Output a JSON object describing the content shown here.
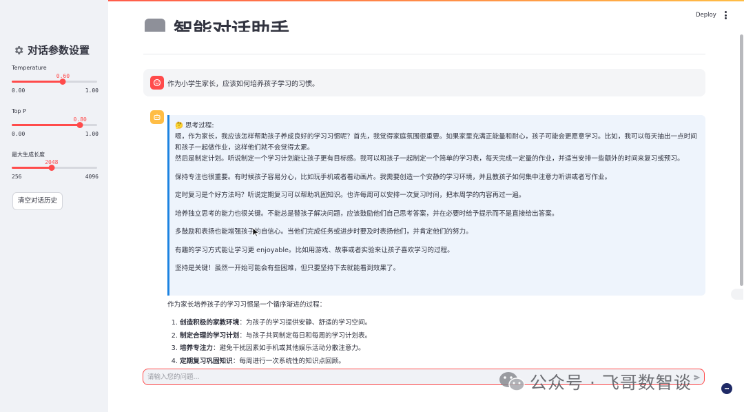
{
  "sidebar": {
    "title": "对话参数设置",
    "icon": "gear-icon",
    "sliders": [
      {
        "label": "Temperature",
        "value": "0.60",
        "min": "0.00",
        "max": "1.00",
        "fraction": 0.6
      },
      {
        "label": "Top P",
        "value": "0.80",
        "min": "0.00",
        "max": "1.00",
        "fraction": 0.8
      },
      {
        "label": "最大生成长度",
        "value": "2048",
        "min": "256",
        "max": "4096",
        "fraction": 0.4667
      }
    ],
    "clear_button": "清空对话历史"
  },
  "header": {
    "deploy": "Deploy",
    "title": "智能对话助手"
  },
  "messages": {
    "user": "作为小学生家长，应该如何培养孩子学习的习惯。",
    "thinking": {
      "emoji": "🤔",
      "heading": "思考过程:",
      "paragraphs": [
        "嗯，作为家长，我应该怎样帮助孩子养成良好的学习习惯呢？首先，我觉得家庭氛围很重要。如果家里充满正能量和耐心，孩子可能会更愿意学习。比如，我可以每天抽出一点时间和孩子一起做作业，这样他们就不会觉得太累。\n然后是制定计划。听说制定一个学习计划能让孩子更有目标感。我可以和孩子一起制定一个简单的学习表，每天完成一定量的作业，并适当安排一些额外的时间来复习或预习。",
        "保持专注也很重要。有时候孩子容易分心，比如玩手机或者看动画片。我需要创造一个安静的学习环境，并且教孩子如何集中注意力听讲或者写作业。",
        "定时复习是个好方法吗？听说定期复习可以帮助巩固知识。也许每周可以安排一次复习时间，把本周学的内容再过一遍。",
        "培养独立思考的能力也很关键。不能总是替孩子解决问题，应该鼓励他们自己思考答案，并在必要时给予提示而不是直接给出答案。",
        "多鼓励和表扬也能增强孩子的自信心。当他们完成任务或进步时要及时表扬他们，并肯定他们的努力。",
        "有趣的学习方式能让学习更 enjoyable。比如用游戏、故事或者实验来让孩子喜欢学习的过程。",
        "坚持是关键！虽然一开始可能会有些困难，但只要坚持下去就能看到效果了。"
      ]
    },
    "answer_intro": "作为家长培养孩子的学习习惯是一个循序渐进的过程：",
    "answer_items": [
      {
        "bold": "创造积极的家教环境",
        "text": "：为孩子的学习提供安静、舒适的学习空间。"
      },
      {
        "bold": "制定合理的学习计划",
        "text": "：与孩子共同制定每日和每周的学习计划表。"
      },
      {
        "bold": "培养专注力",
        "text": "：避免干扰因素如手机或其他娱乐活动分散注意力。"
      },
      {
        "bold": "定期复习巩固知识",
        "text": "：每周进行一次系统性的知识点回顾。"
      }
    ]
  },
  "chat_input": {
    "placeholder": "请输入您的问题..."
  },
  "watermark": {
    "text": "公众号 · 飞哥数智谈"
  },
  "colors": {
    "accent": "#ff4b4b",
    "user_avatar": "#ff4b4b",
    "bot_avatar": "#ffbd45",
    "info_border": "#1c83e1",
    "info_bg": "#eef4fc",
    "sidebar_bg": "#f0f2f6"
  }
}
